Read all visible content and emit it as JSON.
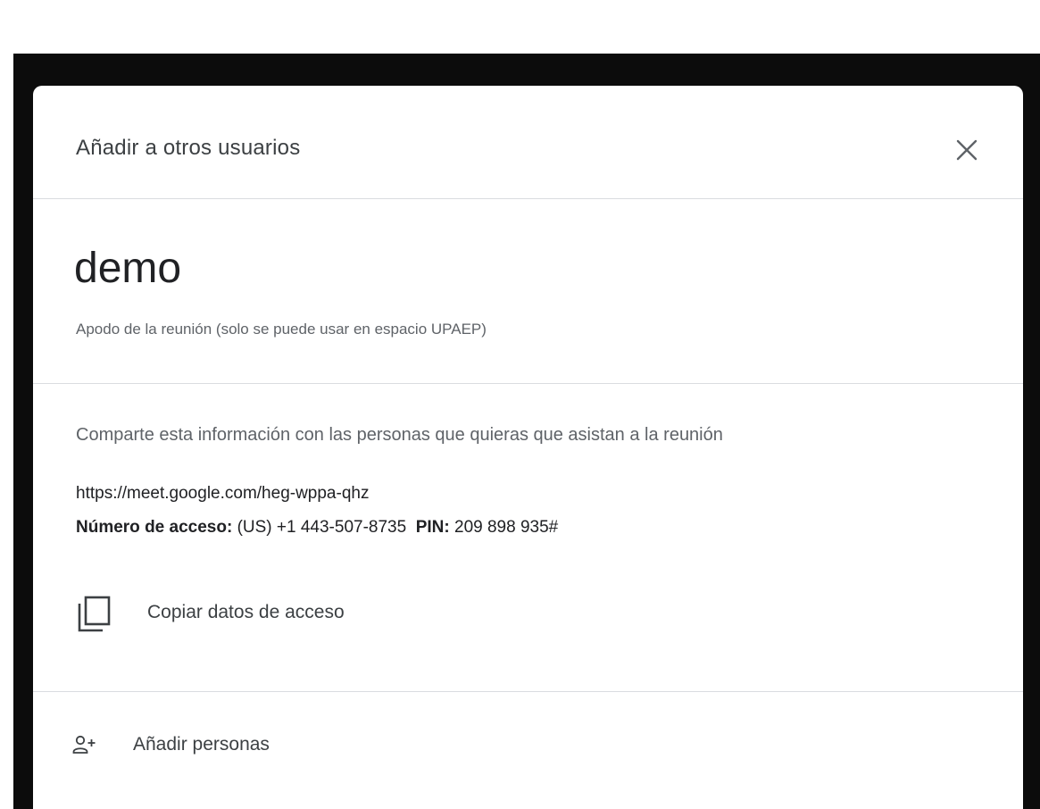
{
  "dialog": {
    "title": "Añadir a otros usuarios",
    "close_icon": "close-icon"
  },
  "meeting": {
    "nickname": "demo",
    "nickname_caption": "Apodo de la reunión (solo se puede usar en espacio UPAEP)"
  },
  "share": {
    "instructions": "Comparte esta información con las personas que quieras que asistan a la reunión",
    "link": "https://meet.google.com/heg-wppa-qhz",
    "access_label": "Número de acceso:",
    "access_number": "(US) +1 443-507-8735",
    "pin_label": "PIN:",
    "pin_value": "209 898 935#"
  },
  "actions": {
    "copy_label": "Copiar datos de acceso",
    "copy_icon": "copy-icon",
    "add_people_label": "Añadir personas",
    "add_people_icon": "add-person-icon"
  }
}
